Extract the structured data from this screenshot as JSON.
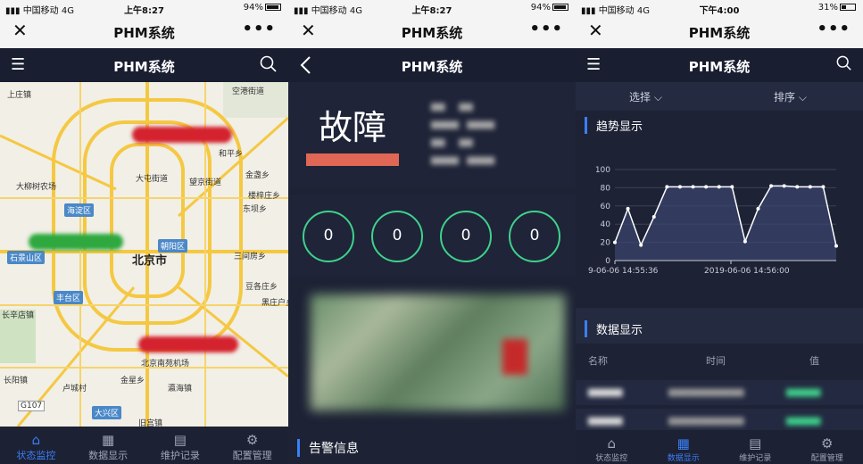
{
  "status": [
    {
      "carrier": "中国移动",
      "net": "4G",
      "time": "上午8:27",
      "battery": "94%",
      "battery_fraction": 0.94
    },
    {
      "carrier": "中国移动",
      "net": "4G",
      "time": "上午8:27",
      "battery": "94%",
      "battery_fraction": 0.94
    },
    {
      "carrier": "中国移动",
      "net": "4G",
      "time": "下午4:00",
      "battery": "31%",
      "battery_fraction": 0.31
    }
  ],
  "wechat": {
    "close": "✕",
    "title": "PHM系统",
    "more": "•••"
  },
  "app_title": "PHM系统",
  "map": {
    "labels": [
      "上庄镇",
      "空港街道",
      "大柳树农场",
      "大屯街道",
      "望京街道",
      "和平乡",
      "金盏乡",
      "楼梓庄乡",
      "东坝乡",
      "北京市",
      "三间房乡",
      "豆各庄乡",
      "黑庄户乡",
      "长辛店镇",
      "北京南苑机场",
      "长阳镇",
      "卢城村",
      "金星乡",
      "瀛海镇",
      "旧宫镇"
    ],
    "districts": [
      "海淀区",
      "朝阳区",
      "石景山区",
      "丰台区",
      "大兴区"
    ],
    "road_label": "G107"
  },
  "tabs1": [
    {
      "label": "状态监控",
      "icon": "home-icon"
    },
    {
      "label": "数据显示",
      "icon": "grid-icon"
    },
    {
      "label": "维护记录",
      "icon": "record-icon"
    },
    {
      "label": "配置管理",
      "icon": "gear-icon"
    }
  ],
  "fault": {
    "status": "故障"
  },
  "gauges": [
    "0",
    "0",
    "0",
    "0"
  ],
  "alarm_title": "告警信息",
  "filters": {
    "select": "选择",
    "sort": "排序"
  },
  "trend": {
    "title": "趋势显示"
  },
  "chart_data": {
    "type": "area",
    "x_tick_labels": [
      "9-06-06 14:55:36",
      "2019-06-06 14:56:00"
    ],
    "ylim": [
      0,
      100
    ],
    "y_ticks": [
      0,
      20,
      40,
      60,
      80,
      100
    ],
    "series": [
      {
        "values": [
          20,
          57,
          17,
          48,
          81,
          81,
          81,
          81,
          81,
          81,
          21,
          57,
          82,
          82,
          81,
          81,
          81,
          16
        ]
      }
    ],
    "grid": true
  },
  "data_section": {
    "title": "数据显示",
    "headers": [
      "名称",
      "时间",
      "值"
    ]
  },
  "tabs3": [
    {
      "label": "状态监控",
      "icon": "home-icon"
    },
    {
      "label": "数据显示",
      "icon": "grid-icon"
    },
    {
      "label": "维护记录",
      "icon": "record-icon"
    },
    {
      "label": "配置管理",
      "icon": "gear-icon"
    }
  ],
  "colors": {
    "accent": "#3b7ff5",
    "fault": "#e06755",
    "gauge": "#3fd18c",
    "bg": "#1d2235"
  }
}
